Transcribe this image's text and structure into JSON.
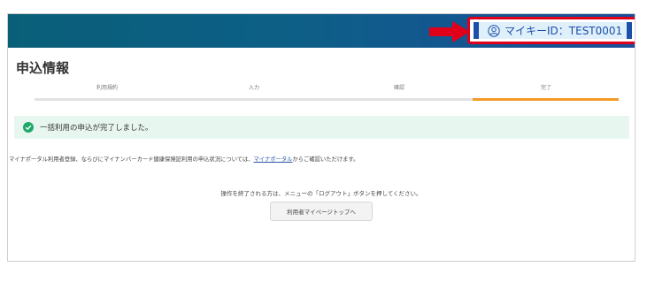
{
  "header": {
    "mykey_id_text": "マイキーID：TEST0001",
    "user_icon": "user-circle-icon",
    "arrow_icon": "red-arrow-right-icon",
    "colors": {
      "header": "#0d5f87",
      "highlight": "#e0001a",
      "id_accent": "#1b4fa8"
    }
  },
  "page": {
    "title": "申込情報"
  },
  "steps": {
    "items": [
      "利用規約",
      "入力",
      "確認",
      "完了"
    ],
    "progress_fraction": 1.0,
    "accent_color": "#f39a27"
  },
  "banner": {
    "icon": "check-circle-icon",
    "text": "一括利用の申込が完了しました。",
    "color": "#e8f6f0"
  },
  "description": {
    "before": "マイナポータル利用者登録、ならびにマイナンバーカード健康保険証利用の申込状況については、",
    "link": "マイナポータル",
    "after": "からご確認いただけます。"
  },
  "instruction": "操作を終了される方は、メニューの「ログアウト」ボタンを押してください。",
  "button": {
    "label": "利用者マイページトップへ"
  }
}
